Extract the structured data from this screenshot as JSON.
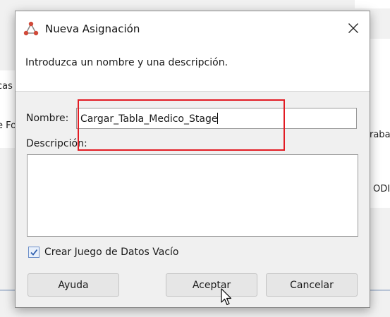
{
  "background": {
    "fragment_left_1": "cas",
    "fragment_left_2": "e Fo",
    "fragment_right_1": "raba",
    "fragment_right_2": "ODI"
  },
  "dialog": {
    "title": "Nueva Asignación",
    "instruction": "Introduzca un nombre y una descripción.",
    "name_label": "Nombre:",
    "name_value": "Cargar_Tabla_Medico_Stage",
    "description_label": "Descripción:",
    "description_value": "",
    "checkbox_label": "Crear Juego de Datos Vacío",
    "checkbox_checked": true,
    "buttons": {
      "help": "Ayuda",
      "accept": "Aceptar",
      "cancel": "Cancelar"
    }
  },
  "colors": {
    "highlight": "#e21b23",
    "app_icon": "#d04a3a"
  },
  "icons": {
    "app": "odi-mapping-icon",
    "close": "close-icon",
    "check": "checkmark-icon",
    "cursor": "mouse-pointer-icon"
  }
}
